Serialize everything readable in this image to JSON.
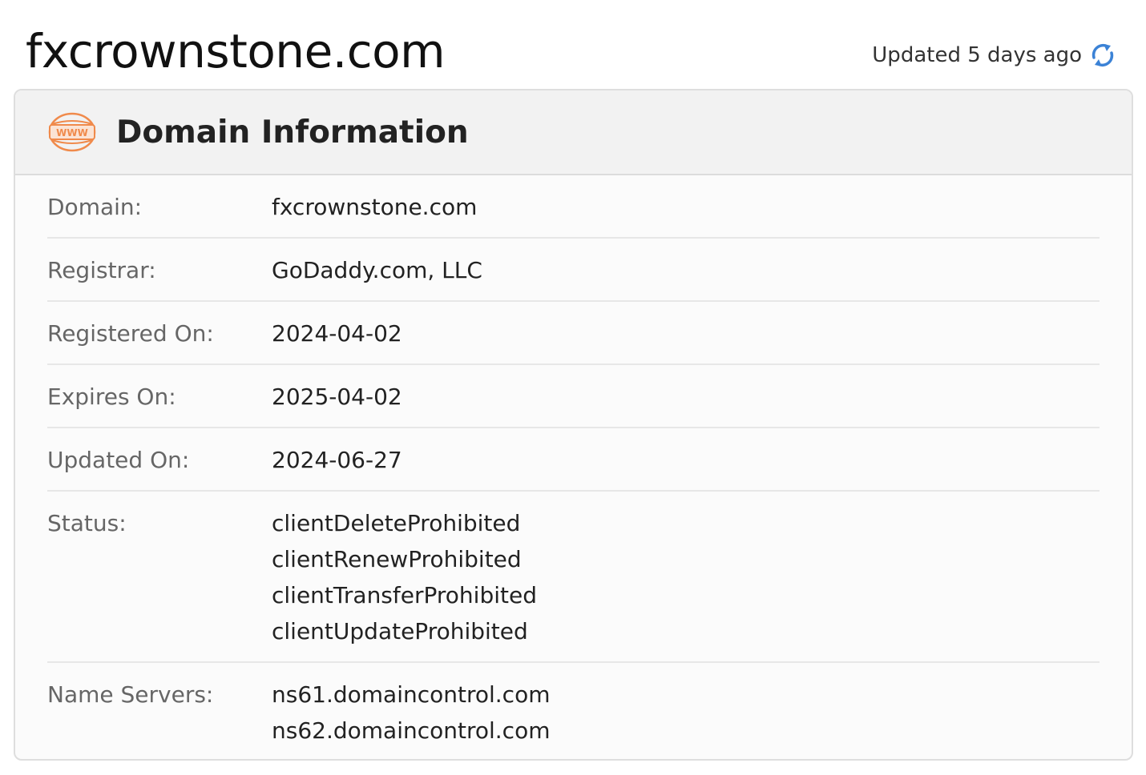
{
  "header": {
    "domain": "fxcrownstone.com",
    "updated_text": "Updated 5 days ago",
    "refresh_icon": "refresh-icon"
  },
  "card": {
    "title": "Domain Information",
    "icon": "www-icon",
    "rows": [
      {
        "label": "Domain:",
        "value": "fxcrownstone.com"
      },
      {
        "label": "Registrar:",
        "value": "GoDaddy.com, LLC"
      },
      {
        "label": "Registered On:",
        "value": "2024-04-02"
      },
      {
        "label": "Expires On:",
        "value": "2025-04-02"
      },
      {
        "label": "Updated On:",
        "value": "2024-06-27"
      }
    ],
    "status": {
      "label": "Status:",
      "values": [
        "clientDeleteProhibited",
        "clientRenewProhibited",
        "clientTransferProhibited",
        "clientUpdateProhibited"
      ]
    },
    "name_servers": {
      "label": "Name Servers:",
      "values": [
        "ns61.domaincontrol.com",
        "ns62.domaincontrol.com"
      ]
    }
  },
  "colors": {
    "accent_orange": "#f08a4b",
    "refresh_blue": "#3b82d6"
  }
}
